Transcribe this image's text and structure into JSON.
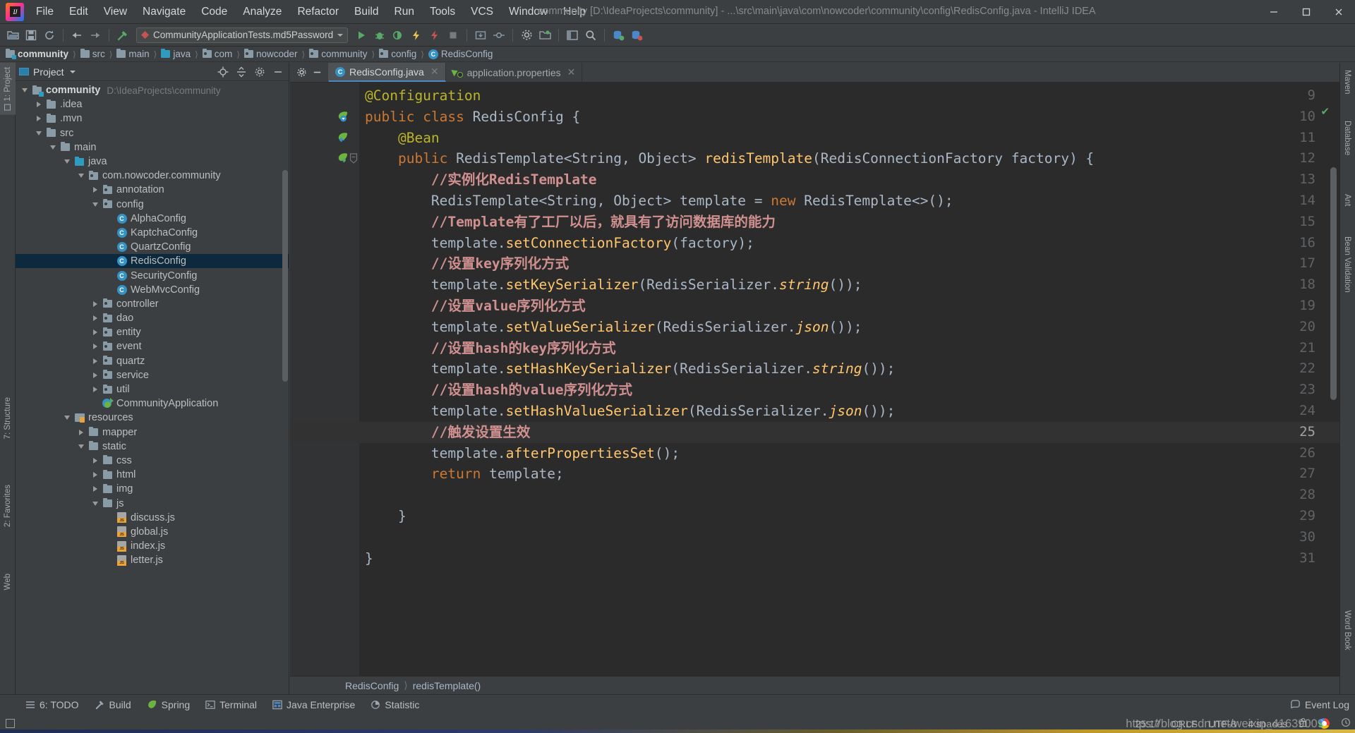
{
  "window": {
    "title": "community [D:\\IdeaProjects\\community] - ...\\src\\main\\java\\com\\nowcoder\\community\\config\\RedisConfig.java - IntelliJ IDEA",
    "minimize": "—",
    "maximize": "□",
    "close": "✕"
  },
  "menu": [
    "File",
    "Edit",
    "View",
    "Navigate",
    "Code",
    "Analyze",
    "Refactor",
    "Build",
    "Run",
    "Tools",
    "VCS",
    "Window",
    "Help"
  ],
  "toolbar": {
    "run_config": "CommunityApplicationTests.md5Password",
    "icons": [
      "open-folder-icon",
      "save-all-icon",
      "sync-icon",
      "back-icon",
      "forward-icon",
      "build-icon",
      "run-icon",
      "debug-icon",
      "run-coverage-icon",
      "run-profile-icon",
      "rerun-icon",
      "stop-icon",
      "toggle-bookmark-icon",
      "settings-icon",
      "project-structure-icon",
      "layout-icon",
      "search-icon",
      "db-import-icon",
      "db-export-icon"
    ]
  },
  "breadcrumb": [
    {
      "label": "community",
      "icon": "module-folder-icon"
    },
    {
      "label": "src",
      "icon": "folder-icon"
    },
    {
      "label": "main",
      "icon": "folder-icon"
    },
    {
      "label": "java",
      "icon": "source-folder-icon"
    },
    {
      "label": "com",
      "icon": "package-icon"
    },
    {
      "label": "nowcoder",
      "icon": "package-icon"
    },
    {
      "label": "community",
      "icon": "package-icon"
    },
    {
      "label": "config",
      "icon": "package-icon"
    },
    {
      "label": "RedisConfig",
      "icon": "class-icon"
    }
  ],
  "left_rail": [
    "1: Project",
    "7: Structure",
    "2: Favorites",
    "Web"
  ],
  "right_rail": [
    "Maven",
    "Database",
    "Ant",
    "Bean Validation",
    "Word Book"
  ],
  "project_panel": {
    "title": "Project",
    "header_icons": [
      "locate-icon",
      "collapse-all-icon",
      "gear-icon",
      "hide-icon"
    ],
    "tree": [
      {
        "depth": 0,
        "tw": "down",
        "icon": "module-folder-icon",
        "label": "community",
        "bold": true,
        "path": "D:\\IdeaProjects\\community"
      },
      {
        "depth": 1,
        "tw": "right",
        "icon": "folder-icon",
        "label": ".idea"
      },
      {
        "depth": 1,
        "tw": "right",
        "icon": "folder-icon",
        "label": ".mvn"
      },
      {
        "depth": 1,
        "tw": "down",
        "icon": "folder-icon",
        "label": "src"
      },
      {
        "depth": 2,
        "tw": "down",
        "icon": "folder-icon",
        "label": "main"
      },
      {
        "depth": 3,
        "tw": "down",
        "icon": "source-folder-icon",
        "label": "java"
      },
      {
        "depth": 4,
        "tw": "down",
        "icon": "package-icon",
        "label": "com.nowcoder.community"
      },
      {
        "depth": 5,
        "tw": "right",
        "icon": "package-icon",
        "label": "annotation"
      },
      {
        "depth": 5,
        "tw": "down",
        "icon": "package-icon",
        "label": "config"
      },
      {
        "depth": 6,
        "tw": "none",
        "icon": "class-icon",
        "label": "AlphaConfig"
      },
      {
        "depth": 6,
        "tw": "none",
        "icon": "class-icon",
        "label": "KaptchaConfig"
      },
      {
        "depth": 6,
        "tw": "none",
        "icon": "class-icon",
        "label": "QuartzConfig"
      },
      {
        "depth": 6,
        "tw": "none",
        "icon": "class-icon",
        "label": "RedisConfig",
        "selected": true
      },
      {
        "depth": 6,
        "tw": "none",
        "icon": "class-icon",
        "label": "SecurityConfig"
      },
      {
        "depth": 6,
        "tw": "none",
        "icon": "class-icon",
        "label": "WebMvcConfig"
      },
      {
        "depth": 5,
        "tw": "right",
        "icon": "package-icon",
        "label": "controller"
      },
      {
        "depth": 5,
        "tw": "right",
        "icon": "package-icon",
        "label": "dao"
      },
      {
        "depth": 5,
        "tw": "right",
        "icon": "package-icon",
        "label": "entity"
      },
      {
        "depth": 5,
        "tw": "right",
        "icon": "package-icon",
        "label": "event"
      },
      {
        "depth": 5,
        "tw": "right",
        "icon": "package-icon",
        "label": "quartz"
      },
      {
        "depth": 5,
        "tw": "right",
        "icon": "package-icon",
        "label": "service"
      },
      {
        "depth": 5,
        "tw": "right",
        "icon": "package-icon",
        "label": "util"
      },
      {
        "depth": 5,
        "tw": "none",
        "icon": "spring-app-icon",
        "label": "CommunityApplication"
      },
      {
        "depth": 3,
        "tw": "down",
        "icon": "resources-folder-icon",
        "label": "resources"
      },
      {
        "depth": 4,
        "tw": "right",
        "icon": "folder-icon",
        "label": "mapper"
      },
      {
        "depth": 4,
        "tw": "down",
        "icon": "folder-icon",
        "label": "static"
      },
      {
        "depth": 5,
        "tw": "right",
        "icon": "folder-icon",
        "label": "css"
      },
      {
        "depth": 5,
        "tw": "right",
        "icon": "folder-icon",
        "label": "html"
      },
      {
        "depth": 5,
        "tw": "right",
        "icon": "folder-icon",
        "label": "img"
      },
      {
        "depth": 5,
        "tw": "down",
        "icon": "folder-icon",
        "label": "js"
      },
      {
        "depth": 6,
        "tw": "none",
        "icon": "js-file-icon",
        "label": "discuss.js"
      },
      {
        "depth": 6,
        "tw": "none",
        "icon": "js-file-icon",
        "label": "global.js"
      },
      {
        "depth": 6,
        "tw": "none",
        "icon": "js-file-icon",
        "label": "index.js"
      },
      {
        "depth": 6,
        "tw": "none",
        "icon": "js-file-icon",
        "label": "letter.js"
      }
    ]
  },
  "editor": {
    "tabs": [
      {
        "label": "RedisConfig.java",
        "icon": "class-icon",
        "active": true,
        "close": "✕"
      },
      {
        "label": "application.properties",
        "icon": "spring-properties-icon",
        "active": false,
        "close": "✕"
      }
    ],
    "first_line_number": 9,
    "current_line": 25,
    "lines": [
      {
        "n": 9,
        "gutter": "",
        "text": "@Configuration"
      },
      {
        "n": 10,
        "gutter": "bean-marker",
        "text": "public class RedisConfig {"
      },
      {
        "n": 11,
        "gutter": "impl-marker",
        "text": "    @Bean"
      },
      {
        "n": 12,
        "gutter": "bean-green",
        "text": "    public RedisTemplate<String, Object> redisTemplate(RedisConnectionFactory factory) {"
      },
      {
        "n": 13,
        "gutter": "",
        "text": "        //实例化RedisTemplate"
      },
      {
        "n": 14,
        "gutter": "",
        "text": "        RedisTemplate<String, Object> template = new RedisTemplate<>();"
      },
      {
        "n": 15,
        "gutter": "",
        "text": "        //Template有了工厂以后，就具有了访问数据库的能力"
      },
      {
        "n": 16,
        "gutter": "",
        "text": "        template.setConnectionFactory(factory);"
      },
      {
        "n": 17,
        "gutter": "",
        "text": "        //设置key序列化方式"
      },
      {
        "n": 18,
        "gutter": "",
        "text": "        template.setKeySerializer(RedisSerializer.string());"
      },
      {
        "n": 19,
        "gutter": "",
        "text": "        //设置value序列化方式"
      },
      {
        "n": 20,
        "gutter": "",
        "text": "        template.setValueSerializer(RedisSerializer.json());"
      },
      {
        "n": 21,
        "gutter": "",
        "text": "        //设置hash的key序列化方式"
      },
      {
        "n": 22,
        "gutter": "",
        "text": "        template.setHashKeySerializer(RedisSerializer.string());"
      },
      {
        "n": 23,
        "gutter": "",
        "text": "        //设置hash的value序列化方式"
      },
      {
        "n": 24,
        "gutter": "",
        "text": "        template.setHashValueSerializer(RedisSerializer.json());"
      },
      {
        "n": 25,
        "gutter": "",
        "text": "        //触发设置生效"
      },
      {
        "n": 26,
        "gutter": "",
        "text": "        template.afterPropertiesSet();"
      },
      {
        "n": 27,
        "gutter": "",
        "text": "        return template;"
      },
      {
        "n": 28,
        "gutter": "",
        "text": ""
      },
      {
        "n": 29,
        "gutter": "",
        "text": "    }"
      },
      {
        "n": 30,
        "gutter": "",
        "text": ""
      },
      {
        "n": 31,
        "gutter": "",
        "text": "}"
      }
    ],
    "breadcrumb": [
      "RedisConfig",
      "redisTemplate()"
    ],
    "inspection_status": "✔"
  },
  "bottom_bar": {
    "items": [
      {
        "label": "6: TODO",
        "icon": "todo-icon",
        "mnemonic": "6"
      },
      {
        "label": "Build",
        "icon": "build-hammer-icon"
      },
      {
        "label": "Spring",
        "icon": "spring-leaf-icon"
      },
      {
        "label": "Terminal",
        "icon": "terminal-icon"
      },
      {
        "label": "Java Enterprise",
        "icon": "java-enterprise-icon"
      },
      {
        "label": "Statistic",
        "icon": "statistic-icon"
      }
    ],
    "event_log": "Event Log",
    "event_log_icon": "event-log-icon"
  },
  "status_bar": {
    "caret_position": "25:17",
    "line_separator": "CRLF",
    "encoding": "UTF-8",
    "indent": "4 spaces",
    "lock_icon": "lock-icon",
    "git_branch_icon": "branch-icon",
    "memory_icon": "memory-icon",
    "watermark": "https://blog.csdn.net/weixin_41639009"
  }
}
